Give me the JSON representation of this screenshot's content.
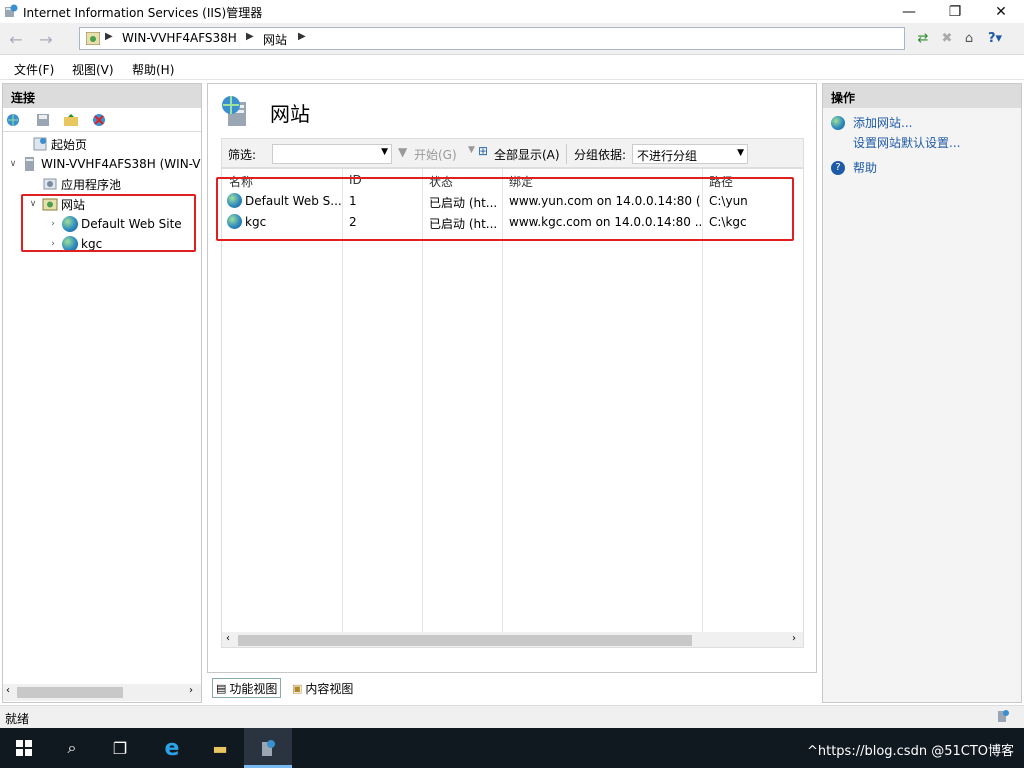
{
  "window": {
    "title": "Internet Information Services (IIS)管理器",
    "controls": [
      "—",
      "❐",
      "✕"
    ]
  },
  "address": {
    "breadcrumbs": [
      "WIN-VVHF4AFS38H",
      "网站"
    ]
  },
  "menu": [
    "文件(F)",
    "视图(V)",
    "帮助(H)"
  ],
  "connections": {
    "title": "连接",
    "tree": {
      "start_page": "起始页",
      "server": "WIN-VVHF4AFS38H (WIN-V",
      "app_pools": "应用程序池",
      "sites": "网站",
      "site_children": [
        "Default Web Site",
        "kgc"
      ]
    }
  },
  "center": {
    "title": "网站",
    "filter_label": "筛选:",
    "start_label": "开始(G)",
    "show_all_label": "全部显示(A)",
    "groupby_label": "分组依据:",
    "groupby_value": "不进行分组",
    "columns": [
      "名称",
      "ID",
      "状态",
      "绑定",
      "路径"
    ],
    "rows": [
      {
        "name": "Default Web S...",
        "id": "1",
        "status": "已启动 (ht...",
        "binding": "www.yun.com on 14.0.0.14:80 (...",
        "path": "C:\\yun"
      },
      {
        "name": "kgc",
        "id": "2",
        "status": "已启动 (ht...",
        "binding": "www.kgc.com on 14.0.0.14:80 ...",
        "path": "C:\\kgc"
      }
    ]
  },
  "view_tabs": [
    "功能视图",
    "内容视图"
  ],
  "actions": {
    "title": "操作",
    "add_site": "添加网站...",
    "default_settings": "设置网站默认设置...",
    "help": "帮助"
  },
  "status": "就绪",
  "tray": "^https://blog.csdn @51CTO博客",
  "colors": {
    "highlight_box": "#e02020",
    "link": "#1e5aa8",
    "taskbar": "#101820"
  }
}
